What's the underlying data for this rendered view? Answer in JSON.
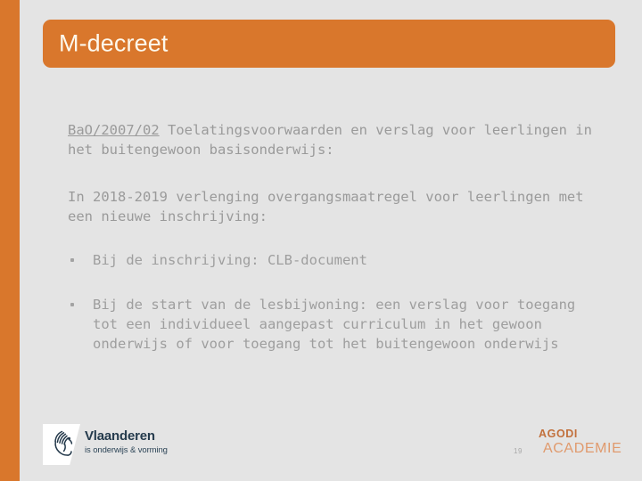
{
  "slide": {
    "title": "M-decreet",
    "accent_color": "#d9772c",
    "background_color": "#e4e4e4",
    "body_text_color": "#9a9a9a"
  },
  "body": {
    "paragraph_1": {
      "reference": "BaO/2007/02",
      "text": " Toelatingsvoorwaarden en verslag voor leerlingen in het buitengewoon basisonderwijs:"
    },
    "paragraph_2": "In 2018-2019 verlenging overgangsmaatregel voor leerlingen met een nieuwe inschrijving:",
    "bullets": [
      "Bij de inschrijving: CLB-document",
      "Bij de start van de lesbijwoning: een verslag voor toegang tot een individueel aangepast curriculum in het gewoon onderwijs of voor toegang tot het buitengewoon onderwijs"
    ]
  },
  "footer": {
    "logo": {
      "name": "Vlaanderen",
      "tagline": "is onderwijs & vorming",
      "icon": "flanders-lion-icon"
    },
    "page_number": "19",
    "brand_line_1": "AGODI",
    "brand_line_2": "ACADEMIE",
    "brand_color_1": "#c2703c",
    "brand_color_2": "#e09a6d"
  }
}
